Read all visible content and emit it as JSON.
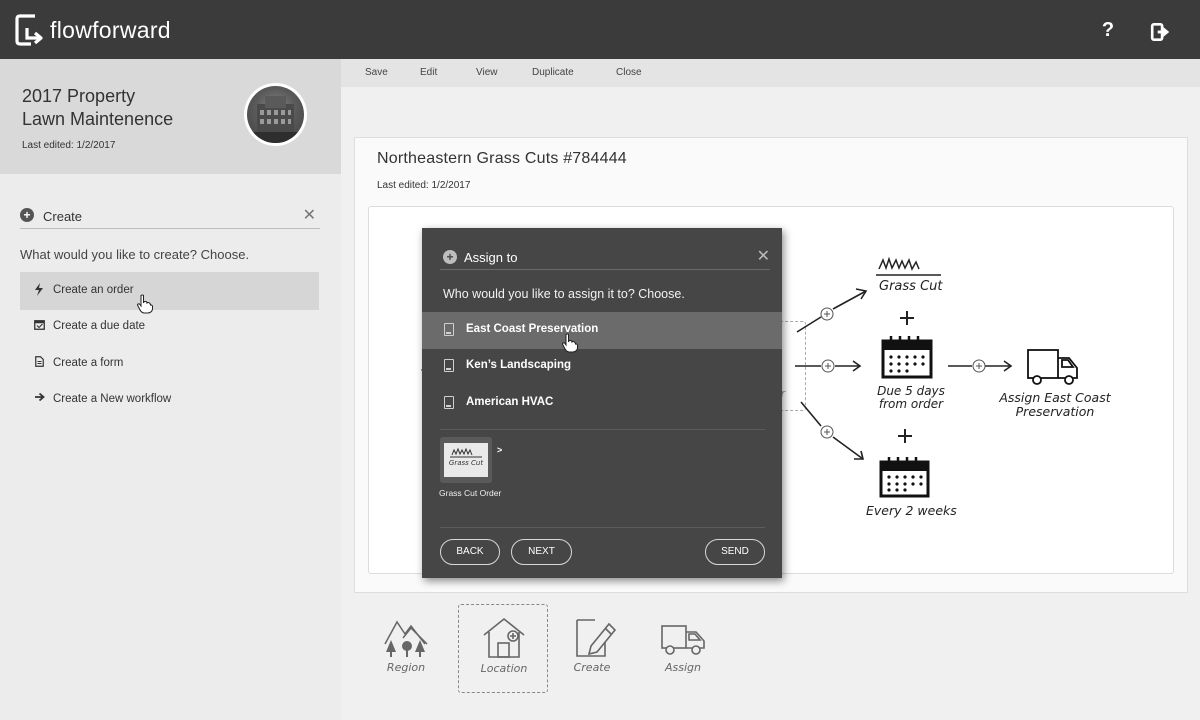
{
  "app": {
    "brand": "flowforward",
    "help_icon": "question-icon",
    "logout_icon": "logout-icon"
  },
  "project": {
    "title": "2017 Property\nLawn Maintenence",
    "last_edited": "Last edited: 1/2/2017"
  },
  "create_panel": {
    "label": "Create",
    "prompt": "What would you like to create? Choose.",
    "items": [
      {
        "label": "Create an order",
        "icon": "bolt-icon",
        "active": true
      },
      {
        "label": "Create a due date",
        "icon": "calendar-icon",
        "active": false
      },
      {
        "label": "Create a form",
        "icon": "form-icon",
        "active": false
      },
      {
        "label": "Create a New workflow",
        "icon": "arrow-right-icon",
        "active": false
      }
    ]
  },
  "toolbar": {
    "items": [
      "Save",
      "Edit",
      "View",
      "Duplicate",
      "Close"
    ]
  },
  "workflow": {
    "title": "Northeastern Grass Cuts  #784444",
    "last_edited": "Last edited: 1/2/2017",
    "diagram": {
      "grass_cut": "Grass Cut",
      "due": "Due 5 days\nfrom order",
      "assign": "Assign East Coast\nPreservation",
      "every": "Every 2 weeks",
      "partial_label": "er"
    }
  },
  "modal": {
    "title": "Assign to",
    "prompt": "Who would you like to assign it to? Choose.",
    "options": [
      {
        "label": "East Coast Preservation",
        "active": true
      },
      {
        "label": "Ken’s Landscaping",
        "active": false
      },
      {
        "label": "American HVAC",
        "active": false
      }
    ],
    "thumb_text": "Grass Cut",
    "thumb_caret": ">",
    "thumb_label": "Grass Cut Order",
    "back": "BACK",
    "next": "NEXT",
    "send": "SEND"
  },
  "steps": [
    {
      "label": "Region",
      "icon": "region-icon",
      "selected": false
    },
    {
      "label": "Location",
      "icon": "house-icon",
      "selected": true
    },
    {
      "label": "Create",
      "icon": "create-icon",
      "selected": false
    },
    {
      "label": "Assign",
      "icon": "truck-icon",
      "selected": false
    }
  ]
}
